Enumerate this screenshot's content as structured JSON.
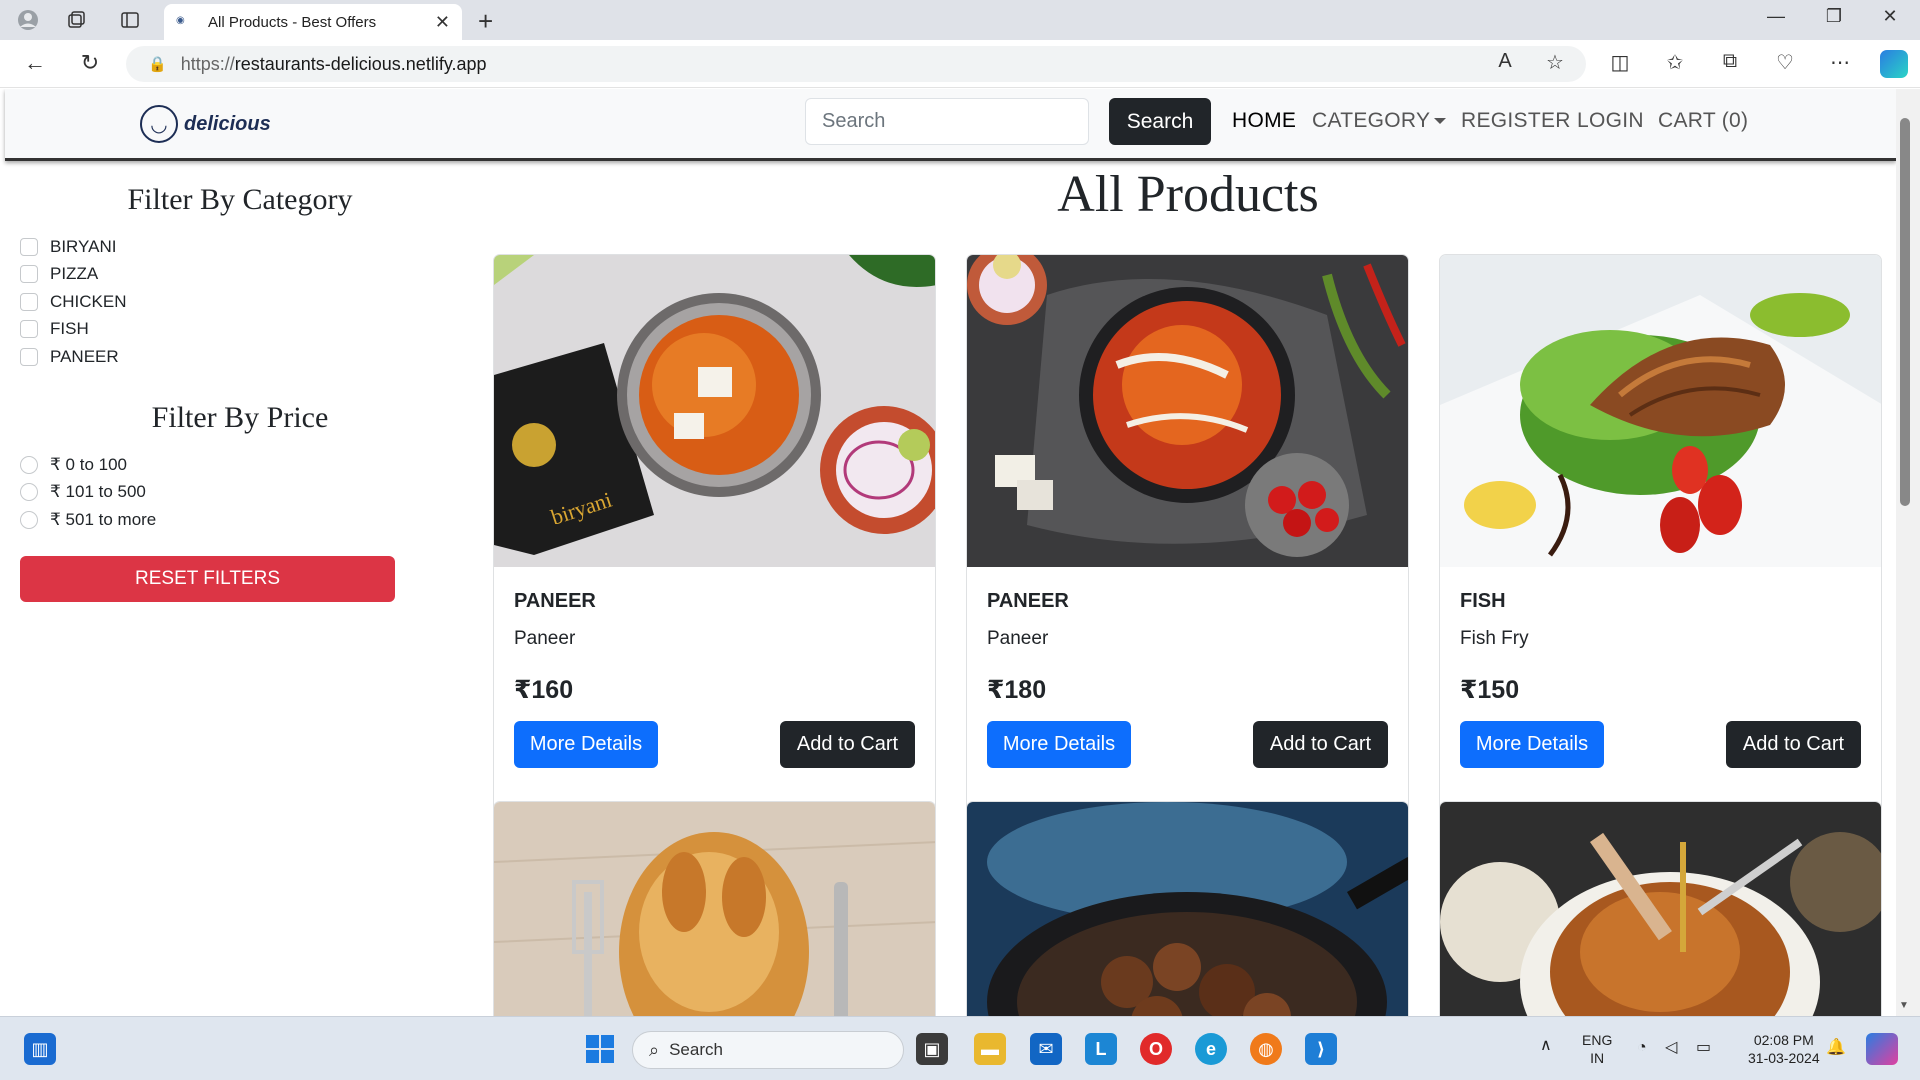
{
  "browser": {
    "tab_title": "All Products - Best Offers",
    "url_proto": "https://",
    "url_host": "restaurants-delicious.netlify.app"
  },
  "navbar": {
    "logo_text": "delicious",
    "search_placeholder": "Search",
    "search_button": "Search",
    "links": [
      "HOME",
      "CATEGORY",
      "REGISTER",
      "LOGIN",
      "CART (0)"
    ]
  },
  "sidebar": {
    "category_title": "Filter By Category",
    "categories": [
      "BIRYANI",
      "PIZZA",
      "CHICKEN",
      "FISH",
      "PANEER"
    ],
    "price_title": "Filter By Price",
    "prices": [
      "₹ 0 to 100",
      "₹ 101 to 500",
      "₹ 501 to more"
    ],
    "reset_button": "RESET FILTERS"
  },
  "main": {
    "title": "All Products",
    "products": [
      {
        "category": "PANEER",
        "name": "Paneer",
        "price": "₹160",
        "more": "More Details",
        "add": "Add to Cart"
      },
      {
        "category": "PANEER",
        "name": "Paneer",
        "price": "₹180",
        "more": "More Details",
        "add": "Add to Cart"
      },
      {
        "category": "FISH",
        "name": "Fish Fry",
        "price": "₹150",
        "more": "More Details",
        "add": "Add to Cart"
      }
    ]
  },
  "taskbar": {
    "search": "Search",
    "lang_top": "ENG",
    "lang_bottom": "IN",
    "time": "02:08 PM",
    "date": "31-03-2024"
  },
  "colors": {
    "primary": "#0d6efd",
    "dark": "#212529",
    "danger": "#dc3545"
  }
}
